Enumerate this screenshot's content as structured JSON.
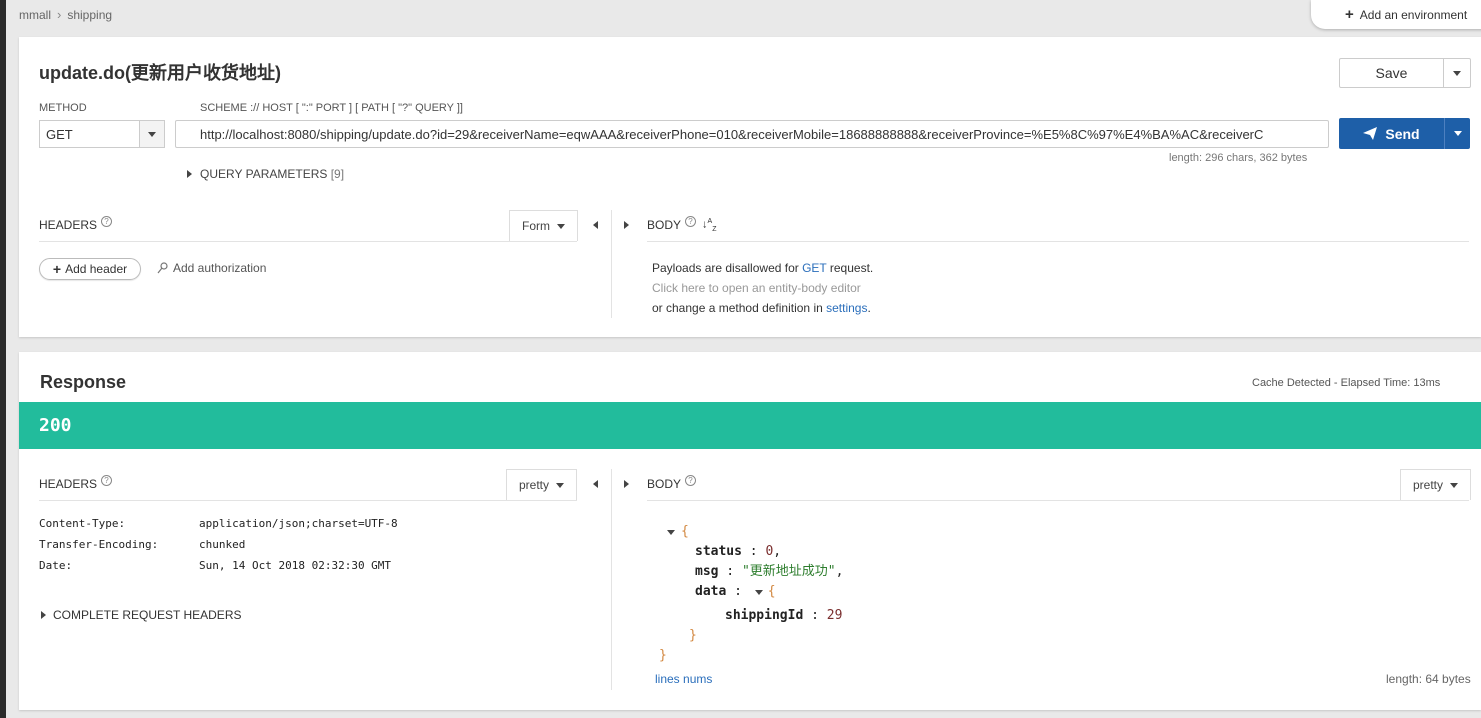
{
  "breadcrumb": {
    "root": "mmall",
    "current": "shipping"
  },
  "env_button": "Add an environment",
  "request": {
    "title": "update.do(更新用户收货地址)",
    "save_label": "Save",
    "method_label": "METHOD",
    "method_value": "GET",
    "url_label": "SCHEME :// HOST [ \":\" PORT ] [ PATH [ \"?\" QUERY ]]",
    "url_value": "http://localhost:8080/shipping/update.do?id=29&receiverName=eqwAAA&receiverPhone=010&receiverMobile=18688888888&receiverProvince=%E5%8C%97%E4%BA%AC&receiverC",
    "length_info": "length: 296 chars, 362 bytes",
    "send_label": "Send",
    "query_params_label": "QUERY PARAMETERS",
    "query_params_count": "[9]",
    "headers_label": "HEADERS",
    "headers_mode": "Form",
    "body_label": "BODY",
    "add_header": "Add header",
    "add_authorization": "Add authorization",
    "body_msg_1a": "Payloads are disallowed for ",
    "body_msg_1b": "GET",
    "body_msg_1c": " request.",
    "body_msg_2": "Click here to open an entity-body editor",
    "body_msg_3a": "or change a method definition in ",
    "body_msg_3b": "settings",
    "body_msg_3c": "."
  },
  "response": {
    "title": "Response",
    "cache_info": "Cache Detected - Elapsed Time: 13ms",
    "status_code": "200",
    "headers_label": "HEADERS",
    "headers_mode": "pretty",
    "body_label": "BODY",
    "body_mode": "pretty",
    "headers": [
      {
        "key": "Content-Type:",
        "value": "application/json;charset=UTF-8"
      },
      {
        "key": "Transfer-Encoding:",
        "value": "chunked"
      },
      {
        "key": "Date:",
        "value": "Sun, 14 Oct 2018 02:32:30 GMT"
      }
    ],
    "complete_headers": "COMPLETE REQUEST HEADERS",
    "json": {
      "open": "{",
      "status_key": "status",
      "status_val": "0",
      "msg_key": "msg",
      "msg_val": "\"更新地址成功\"",
      "data_key": "data",
      "shipping_key": "shippingId",
      "shipping_val": "29",
      "close": "}"
    },
    "lines_nums": "lines nums",
    "length_info": "length: 64 bytes"
  },
  "colors": {
    "status_bar": "#22bc9c",
    "send": "#1e5fa8",
    "link": "#2a6ebb"
  }
}
